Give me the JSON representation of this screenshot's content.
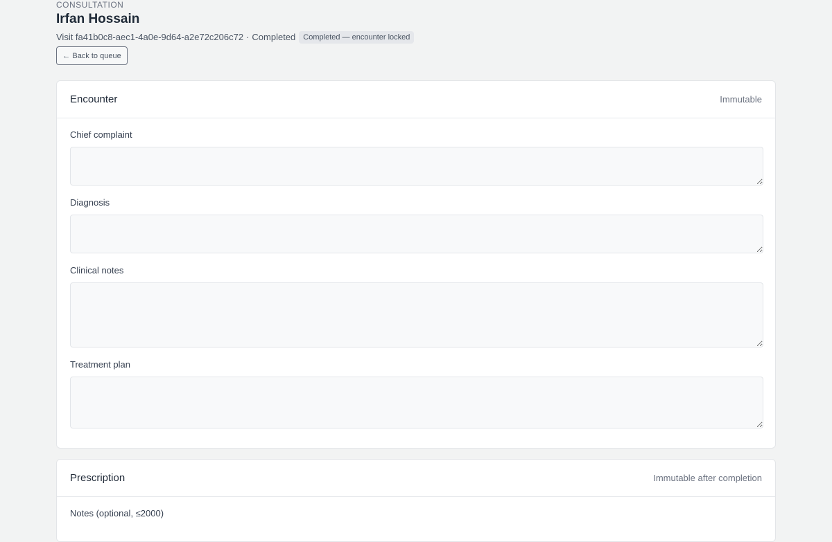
{
  "header": {
    "eyebrow": "CONSULTATION",
    "patient_name": "Irfan Hossain",
    "visit_label": "Visit fa41b0c8-aec1-4a0e-9d64-a2e72c206c72",
    "separator": "·",
    "status": "Completed",
    "lock_badge": "Completed — encounter locked",
    "back_label": "← Back to queue"
  },
  "encounter": {
    "title": "Encounter",
    "meta": "Immutable",
    "fields": [
      {
        "label": "Chief complaint",
        "value": ""
      },
      {
        "label": "Diagnosis",
        "value": ""
      },
      {
        "label": "Clinical notes",
        "value": ""
      },
      {
        "label": "Treatment plan",
        "value": ""
      }
    ]
  },
  "prescription": {
    "title": "Prescription",
    "meta": "Immutable after completion",
    "notes_label": "Notes (optional, ≤2000)"
  }
}
